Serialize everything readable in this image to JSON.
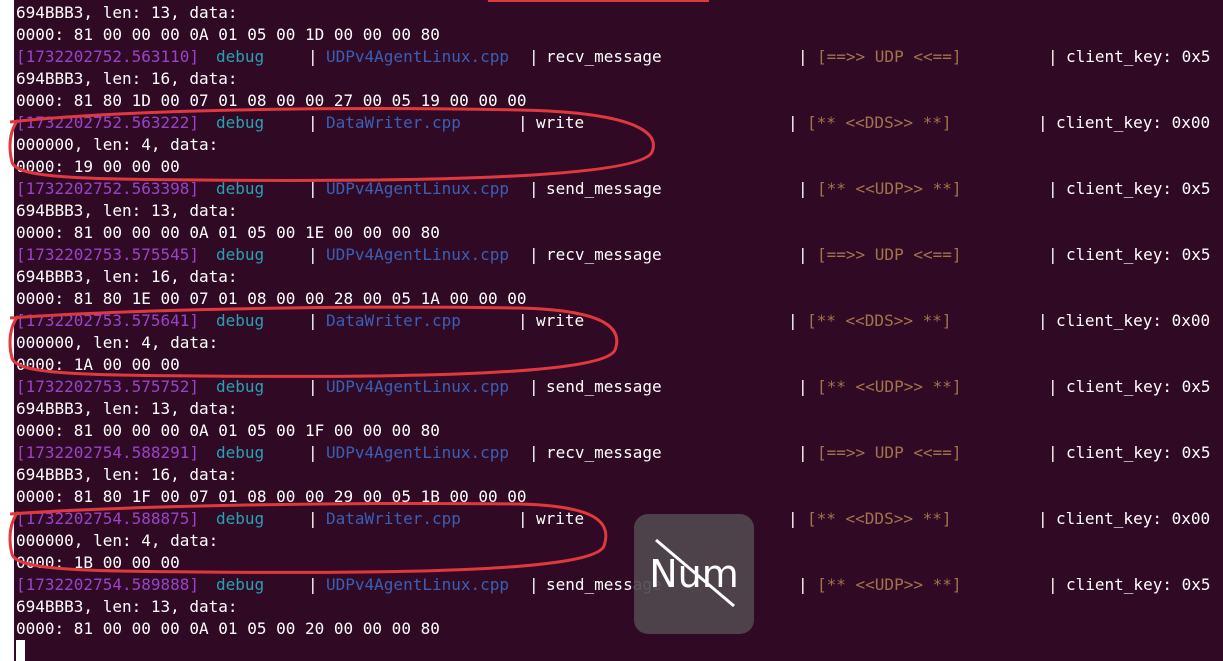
{
  "terminal": {
    "lines": [
      {
        "kind": "text",
        "text": "694BBB3, len: 13, data:"
      },
      {
        "kind": "text",
        "text": "0000: 81 00 00 00 0A 01 05 00 1D 00 00 00 80"
      },
      {
        "kind": "log",
        "ts": "[1732202752.563110]",
        "level": "debug",
        "pipe1": "|",
        "file": "UDPv4AgentLinux.cpp",
        "pipe2": "|",
        "func": "recv_message",
        "pipe3": "|",
        "tag": "[==>> UDP <<==]",
        "pipe4": "|",
        "key": "client_key: 0x5",
        "fileClass": "c-file-udp",
        "layout": "a"
      },
      {
        "kind": "text",
        "text": "694BBB3, len: 16, data:"
      },
      {
        "kind": "text",
        "text": "0000: 81 80 1D 00 07 01 08 00 00 27 00 05 19 00 00 00"
      },
      {
        "kind": "log",
        "ts": "[1732202752.563222]",
        "level": "debug",
        "pipe1": "|",
        "file": "DataWriter.cpp",
        "pipe2": "|",
        "func": "write",
        "pipe3": "|",
        "tag": "[** <<DDS>> **]",
        "pipe4": "|",
        "key": "client_key: 0x00",
        "fileClass": "c-file-dw",
        "layout": "b"
      },
      {
        "kind": "text",
        "text": "000000, len: 4, data:"
      },
      {
        "kind": "text",
        "text": "0000: 19 00 00 00"
      },
      {
        "kind": "log",
        "ts": "[1732202752.563398]",
        "level": "debug",
        "pipe1": "|",
        "file": "UDPv4AgentLinux.cpp",
        "pipe2": "|",
        "func": "send_message",
        "pipe3": "|",
        "tag": "[** <<UDP>> **]",
        "pipe4": "|",
        "key": "client_key: 0x5",
        "fileClass": "c-file-udp",
        "layout": "a"
      },
      {
        "kind": "text",
        "text": "694BBB3, len: 13, data:"
      },
      {
        "kind": "text",
        "text": "0000: 81 00 00 00 0A 01 05 00 1E 00 00 00 80"
      },
      {
        "kind": "log",
        "ts": "[1732202753.575545]",
        "level": "debug",
        "pipe1": "|",
        "file": "UDPv4AgentLinux.cpp",
        "pipe2": "|",
        "func": "recv_message",
        "pipe3": "|",
        "tag": "[==>> UDP <<==]",
        "pipe4": "|",
        "key": "client_key: 0x5",
        "fileClass": "c-file-udp",
        "layout": "a"
      },
      {
        "kind": "text",
        "text": "694BBB3, len: 16, data:"
      },
      {
        "kind": "text",
        "text": "0000: 81 80 1E 00 07 01 08 00 00 28 00 05 1A 00 00 00"
      },
      {
        "kind": "log",
        "ts": "[1732202753.575641]",
        "level": "debug",
        "pipe1": "|",
        "file": "DataWriter.cpp",
        "pipe2": "|",
        "func": "write",
        "pipe3": "|",
        "tag": "[** <<DDS>> **]",
        "pipe4": "|",
        "key": "client_key: 0x00",
        "fileClass": "c-file-dw",
        "layout": "b"
      },
      {
        "kind": "text",
        "text": "000000, len: 4, data:"
      },
      {
        "kind": "text",
        "text": "0000: 1A 00 00 00"
      },
      {
        "kind": "log",
        "ts": "[1732202753.575752]",
        "level": "debug",
        "pipe1": "|",
        "file": "UDPv4AgentLinux.cpp",
        "pipe2": "|",
        "func": "send_message",
        "pipe3": "|",
        "tag": "[** <<UDP>> **]",
        "pipe4": "|",
        "key": "client_key: 0x5",
        "fileClass": "c-file-udp",
        "layout": "a"
      },
      {
        "kind": "text",
        "text": "694BBB3, len: 13, data:"
      },
      {
        "kind": "text",
        "text": "0000: 81 00 00 00 0A 01 05 00 1F 00 00 00 80"
      },
      {
        "kind": "log",
        "ts": "[1732202754.588291]",
        "level": "debug",
        "pipe1": "|",
        "file": "UDPv4AgentLinux.cpp",
        "pipe2": "|",
        "func": "recv_message",
        "pipe3": "|",
        "tag": "[==>> UDP <<==]",
        "pipe4": "|",
        "key": "client_key: 0x5",
        "fileClass": "c-file-udp",
        "layout": "a"
      },
      {
        "kind": "text",
        "text": "694BBB3, len: 16, data:"
      },
      {
        "kind": "text",
        "text": "0000: 81 80 1F 00 07 01 08 00 00 29 00 05 1B 00 00 00"
      },
      {
        "kind": "log",
        "ts": "[1732202754.588875]",
        "level": "debug",
        "pipe1": "|",
        "file": "DataWriter.cpp",
        "pipe2": "|",
        "func": "write",
        "pipe3": "|",
        "tag": "[** <<DDS>> **]",
        "pipe4": "|",
        "key": "client_key: 0x00",
        "fileClass": "c-file-dw",
        "layout": "b"
      },
      {
        "kind": "text",
        "text": "000000, len: 4, data:"
      },
      {
        "kind": "text",
        "text": "0000: 1B 00 00 00"
      },
      {
        "kind": "log",
        "ts": "[1732202754.589888]",
        "level": "debug",
        "pipe1": "|",
        "file": "UDPv4AgentLinux.cpp",
        "pipe2": "|",
        "func": "send_message",
        "pipe3": "|",
        "tag": "[** <<UDP>> **]",
        "pipe4": "|",
        "key": "client_key: 0x5",
        "fileClass": "c-file-udp",
        "layout": "a"
      },
      {
        "kind": "text",
        "text": "694BBB3, len: 13, data:"
      },
      {
        "kind": "text",
        "text": "0000: 81 00 00 00 0A 01 05 00 20 00 00 00 80"
      }
    ],
    "colors": {
      "background": "#300a24",
      "timestamp": "#9a42c9",
      "level": "#2aa1b3",
      "file": "#3b5fb5",
      "tag": "#a2734c",
      "annotation": "#e0383e"
    }
  },
  "osd": {
    "text": "Num",
    "icon": "num-lock-off-icon"
  }
}
